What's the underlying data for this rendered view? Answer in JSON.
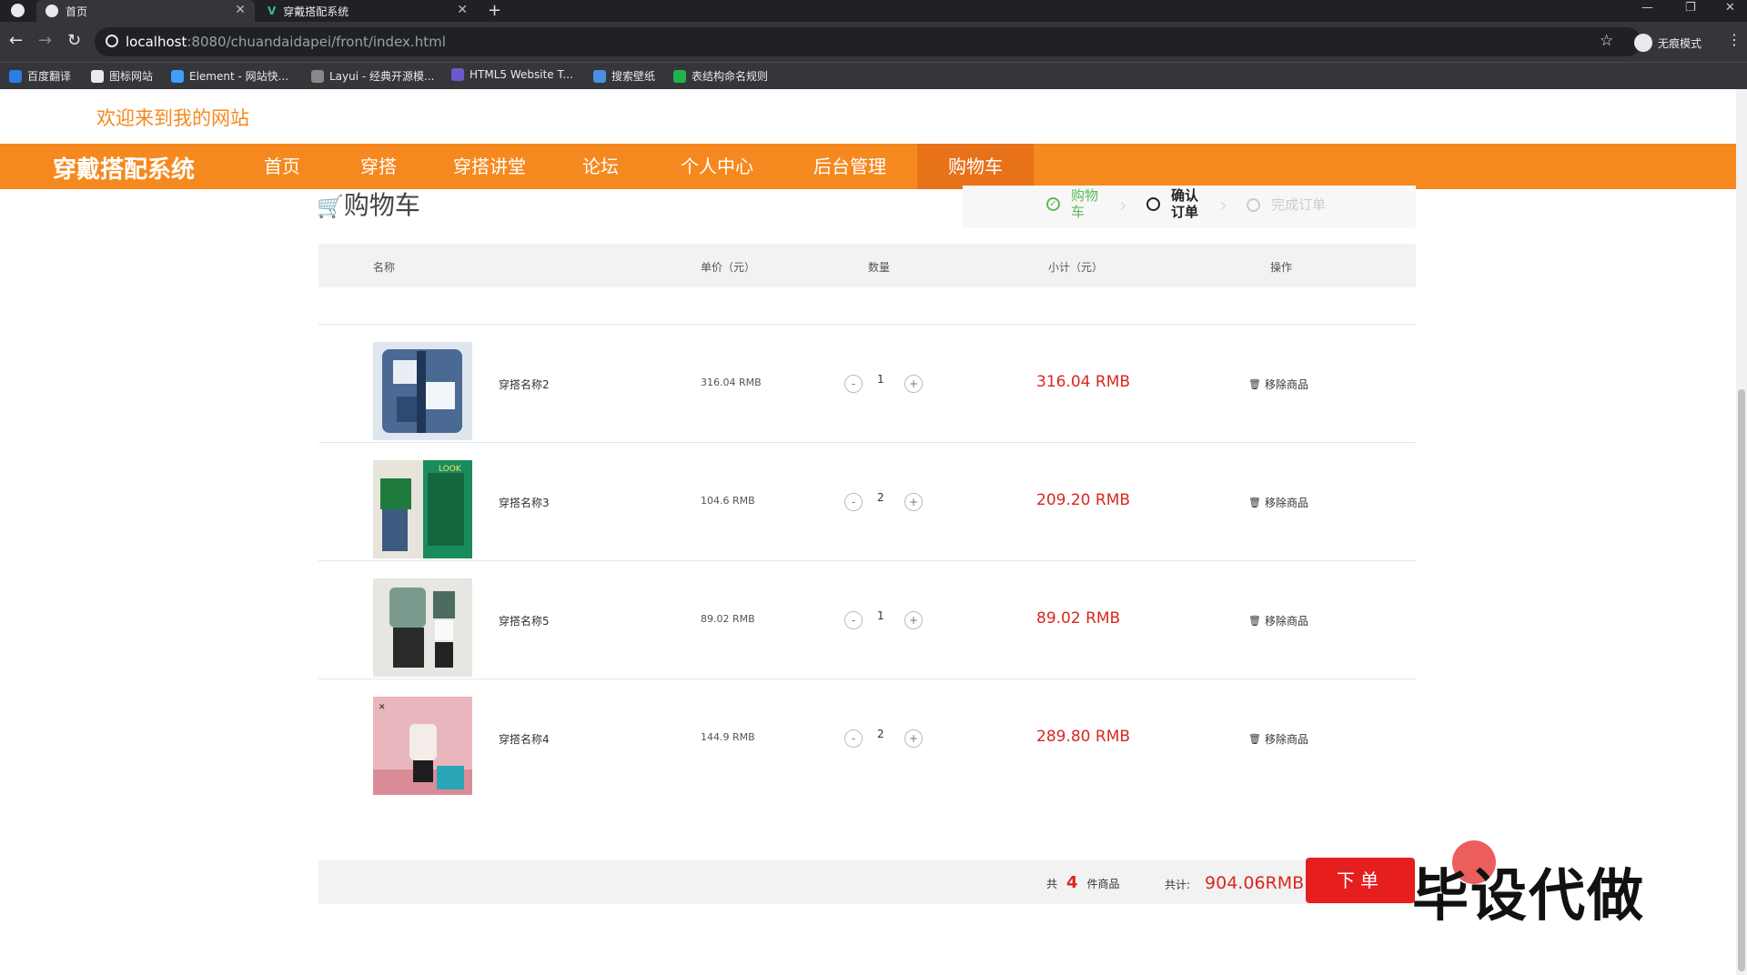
{
  "browser": {
    "tabs": [
      {
        "title": "首页",
        "active": true
      },
      {
        "title": "穿戴搭配系统",
        "active": false
      }
    ],
    "url_host": "localhost",
    "url_path": ":8080/chuandaidapei/front/index.html",
    "incognito_label": "无痕模式",
    "bookmarks": [
      "百度翻译",
      "图标网站",
      "Element - 网站快...",
      "Layui - 经典开源模...",
      "HTML5 Website T...",
      "搜索壁纸",
      "表结构命名规则"
    ]
  },
  "site": {
    "welcome": "欢迎来到我的网站",
    "brand": "穿戴搭配系统",
    "nav": [
      "首页",
      "穿搭",
      "穿搭讲堂",
      "论坛",
      "个人中心",
      "后台管理",
      "购物车"
    ],
    "active_nav": "购物车",
    "accent_color": "#f5891f"
  },
  "cart": {
    "title": "购物车",
    "steps": [
      {
        "label": "购物车",
        "state": "done"
      },
      {
        "label": "确认订单",
        "state": "current"
      },
      {
        "label": "完成订单",
        "state": "todo"
      }
    ],
    "headers": {
      "name": "名称",
      "unit_price": "单价（元）",
      "qty": "数量",
      "subtotal": "小计（元）",
      "action": "操作"
    },
    "items": [
      {
        "name": "穿搭名称2",
        "price": "316.04 RMB",
        "qty": "1",
        "subtotal": "316.04 RMB",
        "remove": "移除商品",
        "image": "denim-jacket"
      },
      {
        "name": "穿搭名称3",
        "price": "104.6 RMB",
        "qty": "2",
        "subtotal": "209.20 RMB",
        "remove": "移除商品",
        "image": "green-sweater-look"
      },
      {
        "name": "穿搭名称5",
        "price": "89.02 RMB",
        "qty": "1",
        "subtotal": "89.02 RMB",
        "remove": "移除商品",
        "image": "green-jacket-set"
      },
      {
        "name": "穿搭名称4",
        "price": "144.9 RMB",
        "qty": "2",
        "subtotal": "289.80 RMB",
        "remove": "移除商品",
        "image": "pink-room-coat"
      }
    ],
    "minus": "-",
    "plus": "+",
    "footer": {
      "count_prefix": "共",
      "count": "4",
      "count_suffix": "件商品",
      "total_label": "共计:",
      "total": "904.06RMB",
      "order_button": "下单"
    }
  },
  "watermark": "毕设代做"
}
